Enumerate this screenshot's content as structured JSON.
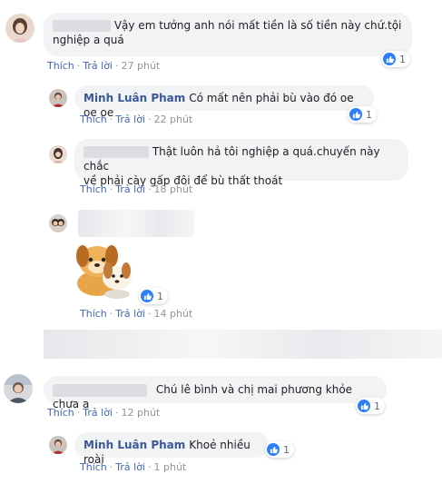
{
  "actions": {
    "like": "Thích",
    "reply": "Trả lời"
  },
  "comments": [
    {
      "text_line1": "Vậy em tưởng anh nói mất tiền là số tiền này chứ.tội",
      "text_line2": "nghiệp a quá",
      "time": "27 phút",
      "likes": "1"
    },
    {
      "author": "Minh Luân Pham",
      "text": "Có mất nên phải bù vào đó oe oe oe",
      "time": "22 phút",
      "likes": "1"
    },
    {
      "text_line1": "Thật luôn hả tôi nghiệp a quá.chuyến này chắc",
      "text_line2": "về phải cày gấp đôi để bù thất thoát",
      "time": "18 phút"
    },
    {
      "sticker": "dog-sticker",
      "time": "14 phút",
      "likes": "1"
    },
    {
      "text": "Chú lê bình và chị mai phương khỏe chưa a",
      "time": "12 phút",
      "likes": "1"
    },
    {
      "author": "Minh Luân Pham",
      "text": "Khoẻ nhiều roài",
      "time": "1 phút",
      "likes": "1"
    }
  ],
  "colors": {
    "link": "#4267b2",
    "name": "#385898",
    "bubble": "#f2f3f5",
    "meta": "#90949c",
    "like_blue": "#2d7ff9"
  }
}
